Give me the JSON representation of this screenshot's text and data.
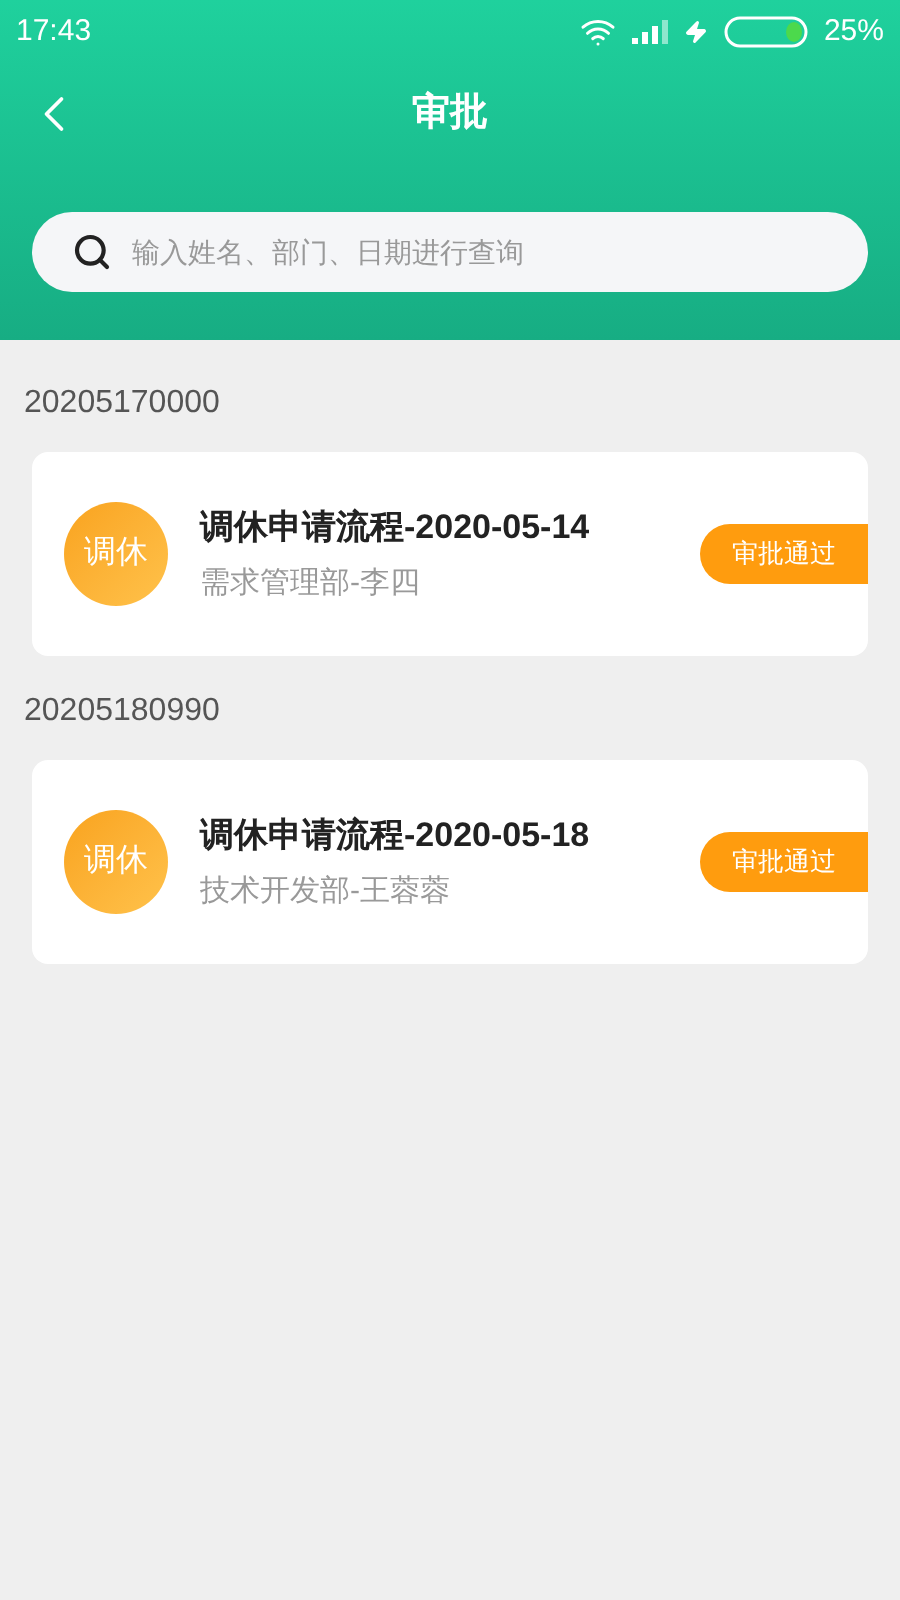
{
  "status_bar": {
    "time": "17:43",
    "battery": "25%"
  },
  "header": {
    "title": "审批"
  },
  "search": {
    "placeholder": "输入姓名、部门、日期进行查询"
  },
  "groups": [
    {
      "id_label": "20205170000",
      "items": [
        {
          "avatar": "调休",
          "title": "调休申请流程-2020-05-14",
          "subtitle": "需求管理部-李四",
          "status": "审批通过"
        }
      ]
    },
    {
      "id_label": "20205180990",
      "items": [
        {
          "avatar": "调休",
          "title": "调休申请流程-2020-05-18",
          "subtitle": "技术开发部-王蓉蓉",
          "status": "审批通过"
        }
      ]
    }
  ]
}
